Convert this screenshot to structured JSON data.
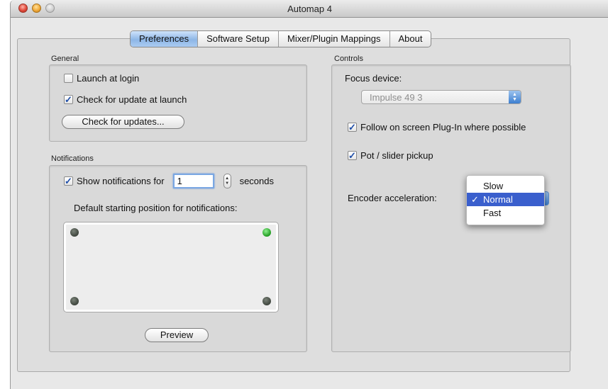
{
  "window": {
    "title": "Automap 4"
  },
  "tabs": [
    "Preferences",
    "Software Setup",
    "Mixer/Plugin Mappings",
    "About"
  ],
  "general": {
    "label": "General",
    "launch_at_login": {
      "label": "Launch at login",
      "checked": false
    },
    "check_update_at_launch": {
      "label": "Check for update at launch",
      "checked": true
    },
    "check_updates_button": "Check for updates..."
  },
  "notifications": {
    "label": "Notifications",
    "show_for": {
      "label": "Show notifications for",
      "checked": true
    },
    "seconds_value": "1",
    "seconds_label": "seconds",
    "position_label": "Default starting position for notifications:",
    "selected_corner": "top-right",
    "preview_button": "Preview"
  },
  "controls": {
    "label": "Controls",
    "focus_device_label": "Focus device:",
    "focus_device_value": "Impulse 49  3",
    "follow_plugin": {
      "label": "Follow on screen Plug-In where possible",
      "checked": true
    },
    "pot_pickup": {
      "label": "Pot / slider pickup",
      "checked": true
    },
    "encoder_label": "Encoder acceleration:",
    "encoder_options": [
      "Slow",
      "Normal",
      "Fast"
    ],
    "encoder_selected": "Normal",
    "check_mark": "✓"
  },
  "colors": {
    "accent": "#3a5fcd",
    "window_bg": "#e8e8e8",
    "dot_active": "#1f9a1f",
    "dot_inactive": "#4a4f49"
  }
}
